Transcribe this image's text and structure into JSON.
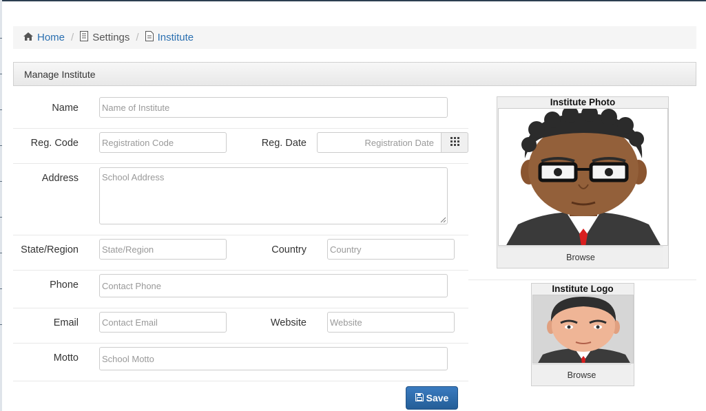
{
  "breadcrumb": {
    "home": "Home",
    "settings": "Settings",
    "institute": "Institute",
    "separator": "/"
  },
  "panel": {
    "title": "Manage Institute"
  },
  "form": {
    "name": {
      "label": "Name",
      "placeholder": "Name of Institute",
      "value": ""
    },
    "reg_code": {
      "label": "Reg. Code",
      "placeholder": "Registration Code",
      "value": ""
    },
    "reg_date": {
      "label": "Reg. Date",
      "placeholder": "Registration Date",
      "value": ""
    },
    "address": {
      "label": "Address",
      "placeholder": "School Address",
      "value": ""
    },
    "state": {
      "label": "State/Region",
      "placeholder": "State/Region",
      "value": ""
    },
    "country": {
      "label": "Country",
      "placeholder": "Country",
      "value": ""
    },
    "phone": {
      "label": "Phone",
      "placeholder": "Contact Phone",
      "value": ""
    },
    "email": {
      "label": "Email",
      "placeholder": "Contact Email",
      "value": ""
    },
    "website": {
      "label": "Website",
      "placeholder": "Website",
      "value": ""
    },
    "motto": {
      "label": "Motto",
      "placeholder": "School Motto",
      "value": ""
    },
    "save_label": "Save"
  },
  "photo": {
    "title": "Institute Photo",
    "browse": "Browse"
  },
  "logo": {
    "title": "Institute Logo",
    "browse": "Browse"
  },
  "icons": {
    "home": "home-icon",
    "settings": "document-icon",
    "institute": "document-icon",
    "calendar": "calendar-grid-icon",
    "save": "floppy-disk-icon"
  },
  "colors": {
    "link": "#2a6fb0",
    "primary_button": "#2f6ca8",
    "breadcrumb_bg": "#f5f5f5"
  }
}
